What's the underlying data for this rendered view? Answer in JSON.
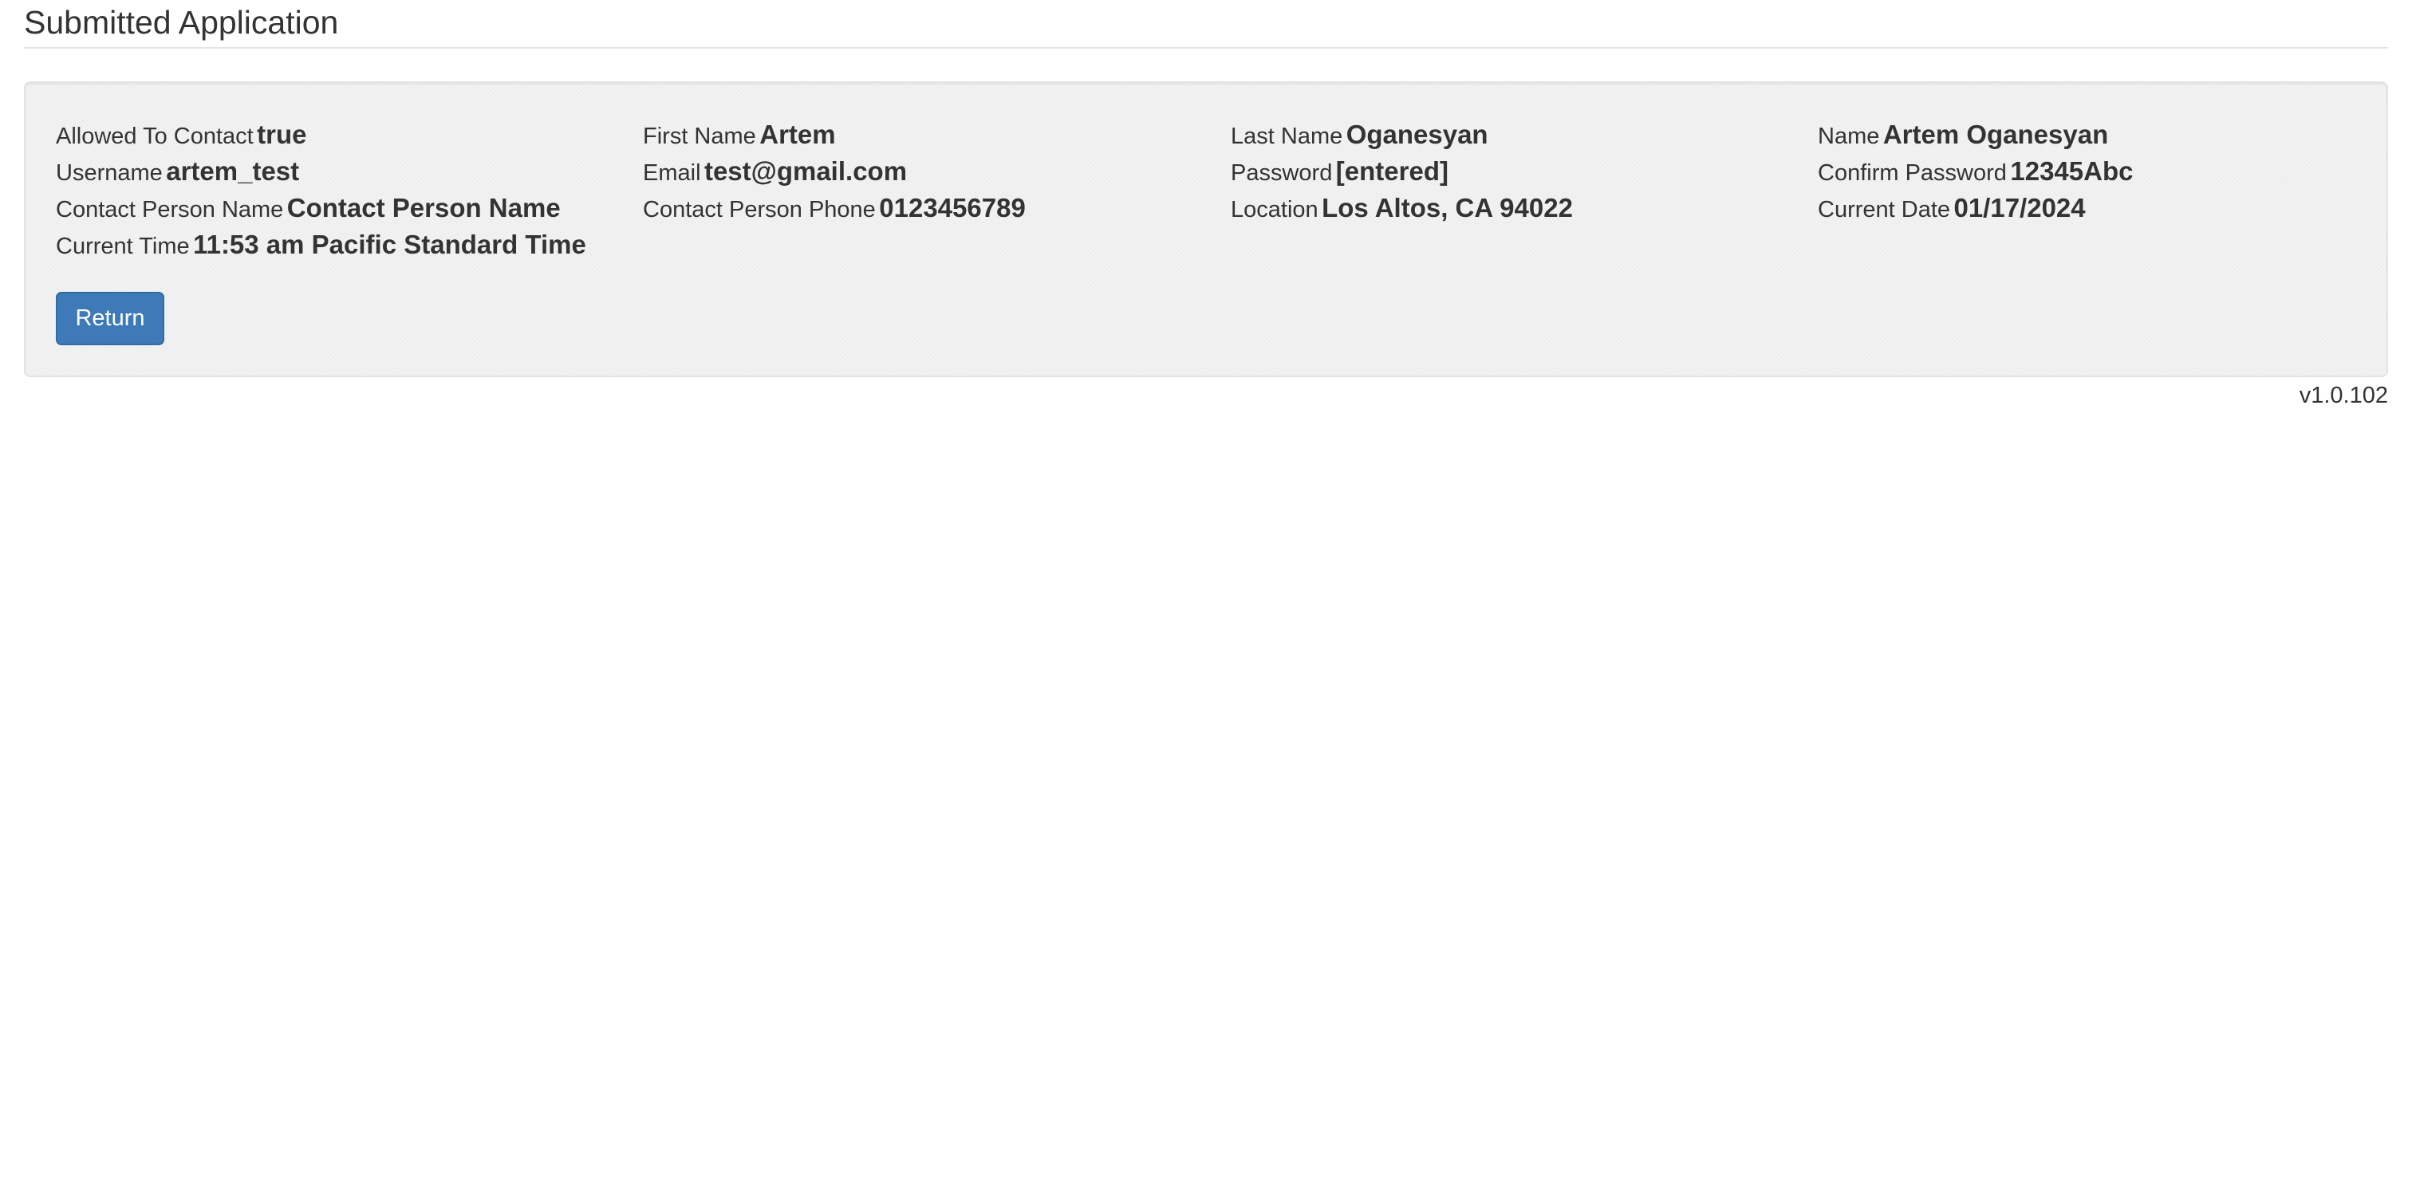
{
  "header": {
    "title": "Submitted Application"
  },
  "fields": {
    "allowed_to_contact": {
      "label": "Allowed To Contact",
      "value": "true"
    },
    "first_name": {
      "label": "First Name",
      "value": "Artem"
    },
    "last_name": {
      "label": "Last Name",
      "value": "Oganesyan"
    },
    "name": {
      "label": "Name",
      "value": "Artem Oganesyan"
    },
    "username": {
      "label": "Username",
      "value": "artem_test"
    },
    "email": {
      "label": "Email",
      "value": "test@gmail.com"
    },
    "password": {
      "label": "Password",
      "value": "[entered]"
    },
    "confirm_password": {
      "label": "Confirm Password",
      "value": "12345Abc"
    },
    "contact_person_name": {
      "label": "Contact Person Name",
      "value": "Contact Person Name"
    },
    "contact_person_phone": {
      "label": "Contact Person Phone",
      "value": "0123456789"
    },
    "location": {
      "label": "Location",
      "value": "Los Altos, CA 94022"
    },
    "current_date": {
      "label": "Current Date",
      "value": "01/17/2024"
    },
    "current_time": {
      "label": "Current Time",
      "value": "11:53 am Pacific Standard Time"
    }
  },
  "actions": {
    "return_label": "Return"
  },
  "footer": {
    "version": "v1.0.102"
  },
  "colors": {
    "primary_button": "#3f7ab8",
    "well_background": "#f3f3f3",
    "text": "#333333"
  }
}
